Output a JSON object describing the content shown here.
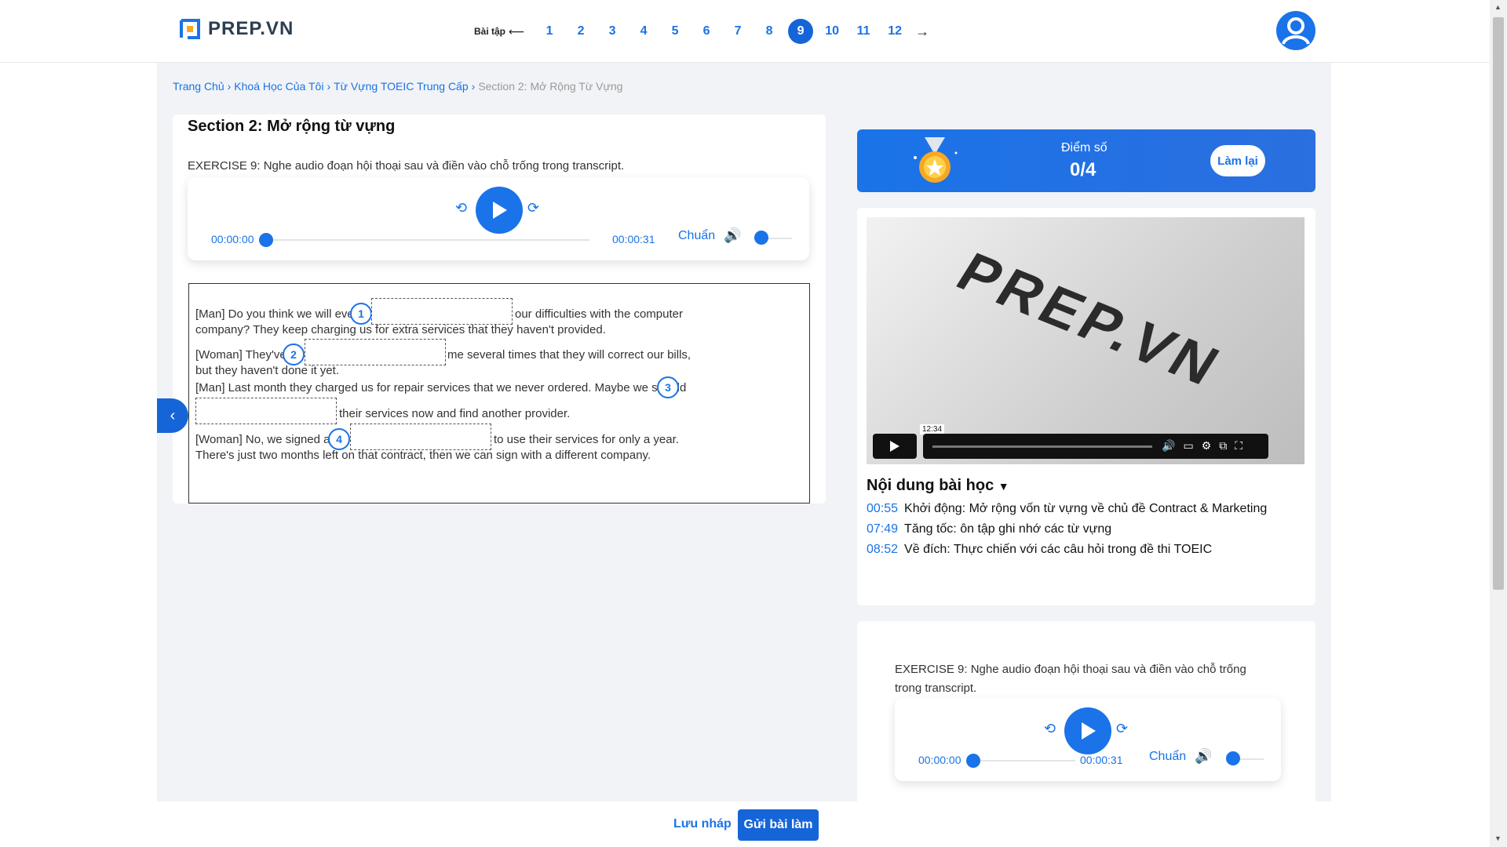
{
  "brand": {
    "name": "PREP.VN"
  },
  "pager": {
    "label": "Bài tập",
    "pages": [
      "1",
      "2",
      "3",
      "4",
      "5",
      "6",
      "7",
      "8",
      "9",
      "10",
      "11",
      "12"
    ],
    "active": "9"
  },
  "breadcrumb": {
    "items": [
      "Trang Chủ",
      "Khoá Học Của Tôi",
      "Từ Vựng TOEIC Trung Cấp"
    ],
    "current": "Section 2: Mở Rộng Từ Vựng"
  },
  "section": {
    "title": "Section 2: Mở rộng từ vựng",
    "exercise": "EXERCISE 9: Nghe audio đoạn hội thoại sau và điền vào chỗ trống trong transcript."
  },
  "player": {
    "current_time": "00:00:00",
    "duration": "00:00:31",
    "speed": "Chuẩn",
    "progress": 0.0
  },
  "transcript": {
    "line1a": "[Man] Do you think we will ever",
    "line1b": "our difficulties with the computer",
    "line1c": "company? They keep charging us for extra services that they haven't provided.",
    "line2a": "[Woman] They've",
    "line2b": "me several times that they will correct our bills,",
    "line2c": "but they haven't done it yet.",
    "line3a": "[Man] Last month they charged us for repair services that we never ordered. Maybe we should",
    "line3b": "their services now and find another provider.",
    "line4a": "[Woman] No, we signed an",
    "line4b": "to use their services for only a year.",
    "line4c": "There's just two months left on that contract, then we can sign with a different company.",
    "blanks": [
      "1",
      "2",
      "3",
      "4"
    ]
  },
  "score": {
    "label": "Điểm số",
    "value": "0/4",
    "retry": "Làm lại"
  },
  "video": {
    "brand": "PREP.VN",
    "duration_tooltip": "12:34"
  },
  "lesson": {
    "title": "Nội dung bài học",
    "items": [
      {
        "time": "00:55",
        "text": "Khởi động: Mở rộng vốn từ vựng về chủ đề Contract & Marketing"
      },
      {
        "time": "07:49",
        "text": "Tăng tốc: ôn tập ghi nhớ các từ vựng"
      },
      {
        "time": "08:52",
        "text": "Về đích: Thực chiến với các câu hỏi trong đề thi TOEIC"
      }
    ]
  },
  "exercise2": {
    "text": "EXERCISE 9: Nghe audio đoạn hội thoại sau và điền vào chỗ trống trong transcript.",
    "current_time": "00:00:00",
    "duration": "00:00:31",
    "speed": "Chuẩn"
  },
  "actions": {
    "save_draft": "Lưu nháp",
    "submit": "Gửi bài làm"
  },
  "colors": {
    "accent": "#1a73e8",
    "accent_dark": "#1565d8"
  }
}
